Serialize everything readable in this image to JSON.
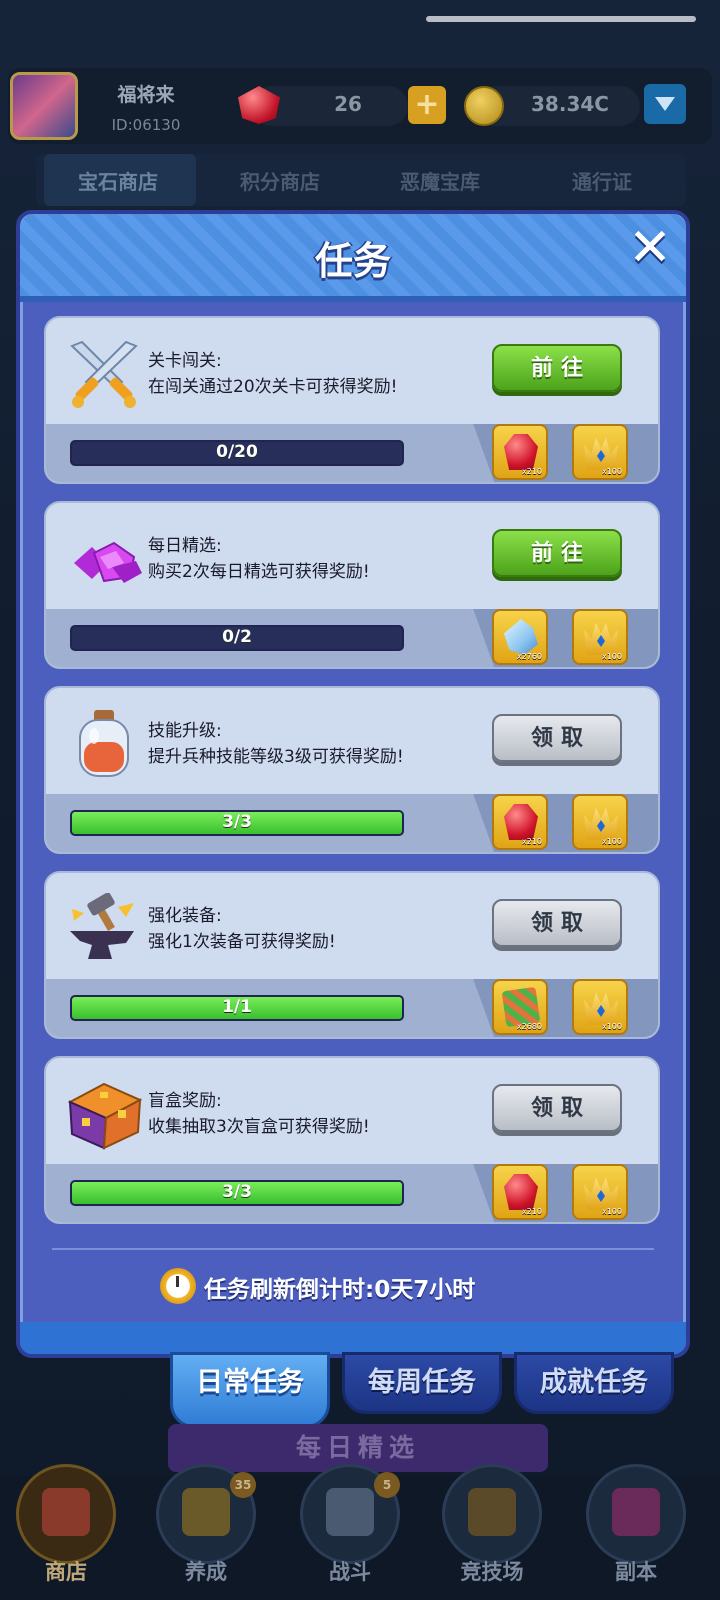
{
  "player": {
    "name": "福将来",
    "id": "ID:06130",
    "gems": "26",
    "coins": "38.34C"
  },
  "shop_tabs": [
    "宝石商店",
    "积分商店",
    "恶魔宝库",
    "通行证"
  ],
  "modal": {
    "title": "任务",
    "close": "✕",
    "refresh_text": "任务刷新倒计时:0天7小时"
  },
  "tasks": [
    {
      "title": "关卡闯关:",
      "desc": "在闯关通过20次关卡可获得奖励!",
      "button": "前往",
      "button_state": "go",
      "progress_text": "0/20",
      "progress": 0.0,
      "rewards": [
        {
          "icon": "ruby-icon",
          "qty": "x210"
        },
        {
          "icon": "crown-icon",
          "qty": "x100"
        }
      ]
    },
    {
      "title": "每日精选:",
      "desc": "购买2次每日精选可获得奖励!",
      "button": "前往",
      "button_state": "go",
      "progress_text": "0/2",
      "progress": 0.0,
      "rewards": [
        {
          "icon": "crystal-icon",
          "qty": "x2760"
        },
        {
          "icon": "crown-icon",
          "qty": "x100"
        }
      ]
    },
    {
      "title": "技能升级:",
      "desc": "提升兵种技能等级3级可获得奖励!",
      "button": "领取",
      "button_state": "claim",
      "progress_text": "3/3",
      "progress": 1.0,
      "rewards": [
        {
          "icon": "ruby-icon",
          "qty": "x210"
        },
        {
          "icon": "crown-icon",
          "qty": "x100"
        }
      ]
    },
    {
      "title": "强化装备:",
      "desc": "强化1次装备可获得奖励!",
      "button": "领取",
      "button_state": "claim",
      "progress_text": "1/1",
      "progress": 1.0,
      "rewards": [
        {
          "icon": "cloth-icon",
          "qty": "x2680"
        },
        {
          "icon": "crown-icon",
          "qty": "x100"
        }
      ]
    },
    {
      "title": "盲盒奖励:",
      "desc": "收集抽取3次盲盒可获得奖励!",
      "button": "领取",
      "button_state": "claim",
      "progress_text": "3/3",
      "progress": 1.0,
      "rewards": [
        {
          "icon": "ruby-icon",
          "qty": "x210"
        },
        {
          "icon": "crown-icon",
          "qty": "x100"
        }
      ]
    }
  ],
  "category_tabs": [
    "日常任务",
    "每周任务",
    "成就任务"
  ],
  "daily_banner": "每日精选",
  "bottom_nav": [
    {
      "label": "商店",
      "badge": ""
    },
    {
      "label": "养成",
      "badge": "35"
    },
    {
      "label": "战斗",
      "badge": "5"
    },
    {
      "label": "竞技场",
      "badge": ""
    },
    {
      "label": "副本",
      "badge": ""
    }
  ],
  "colors": {
    "modal_bg": "#4c5fbf",
    "go_button": "#5fbf24",
    "claim_button": "#c9cdd4",
    "progress_fill": "#4fd43a"
  }
}
